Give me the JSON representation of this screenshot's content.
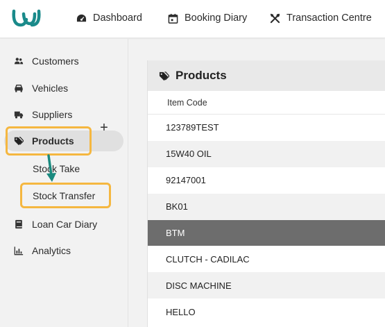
{
  "header": {
    "logo": "logo",
    "nav": [
      {
        "label": "Dashboard",
        "icon": "dashboard-gauge-icon"
      },
      {
        "label": "Booking Diary",
        "icon": "calendar-icon"
      },
      {
        "label": "Transaction Centre",
        "icon": "tools-icon"
      }
    ]
  },
  "sidebar": {
    "items": [
      {
        "label": "Customers",
        "icon": "users-icon"
      },
      {
        "label": "Vehicles",
        "icon": "car-icon"
      },
      {
        "label": "Suppliers",
        "icon": "truck-icon"
      },
      {
        "label": "Products",
        "icon": "tags-icon",
        "active": true
      },
      {
        "label": "Loan Car Diary",
        "icon": "book-icon"
      },
      {
        "label": "Analytics",
        "icon": "chart-bar-icon"
      }
    ],
    "sub_items": [
      {
        "label": "Stock Take"
      },
      {
        "label": "Stock Transfer"
      }
    ],
    "plus_label": "+"
  },
  "panel": {
    "title": "Products",
    "column_header": "Item Code",
    "rows": [
      "123789TEST",
      "15W40 OIL",
      "92147001",
      "BK01",
      "BTM",
      "CLUTCH - CADILAC",
      "DISC MACHINE",
      "HELLO"
    ],
    "selected_row": "BTM"
  },
  "colors": {
    "brand_teal": "#1a8a8a",
    "highlight_orange": "#f5b740",
    "selected_row_bg": "#6d6d6d",
    "arrow_teal": "#1a8a7f"
  }
}
